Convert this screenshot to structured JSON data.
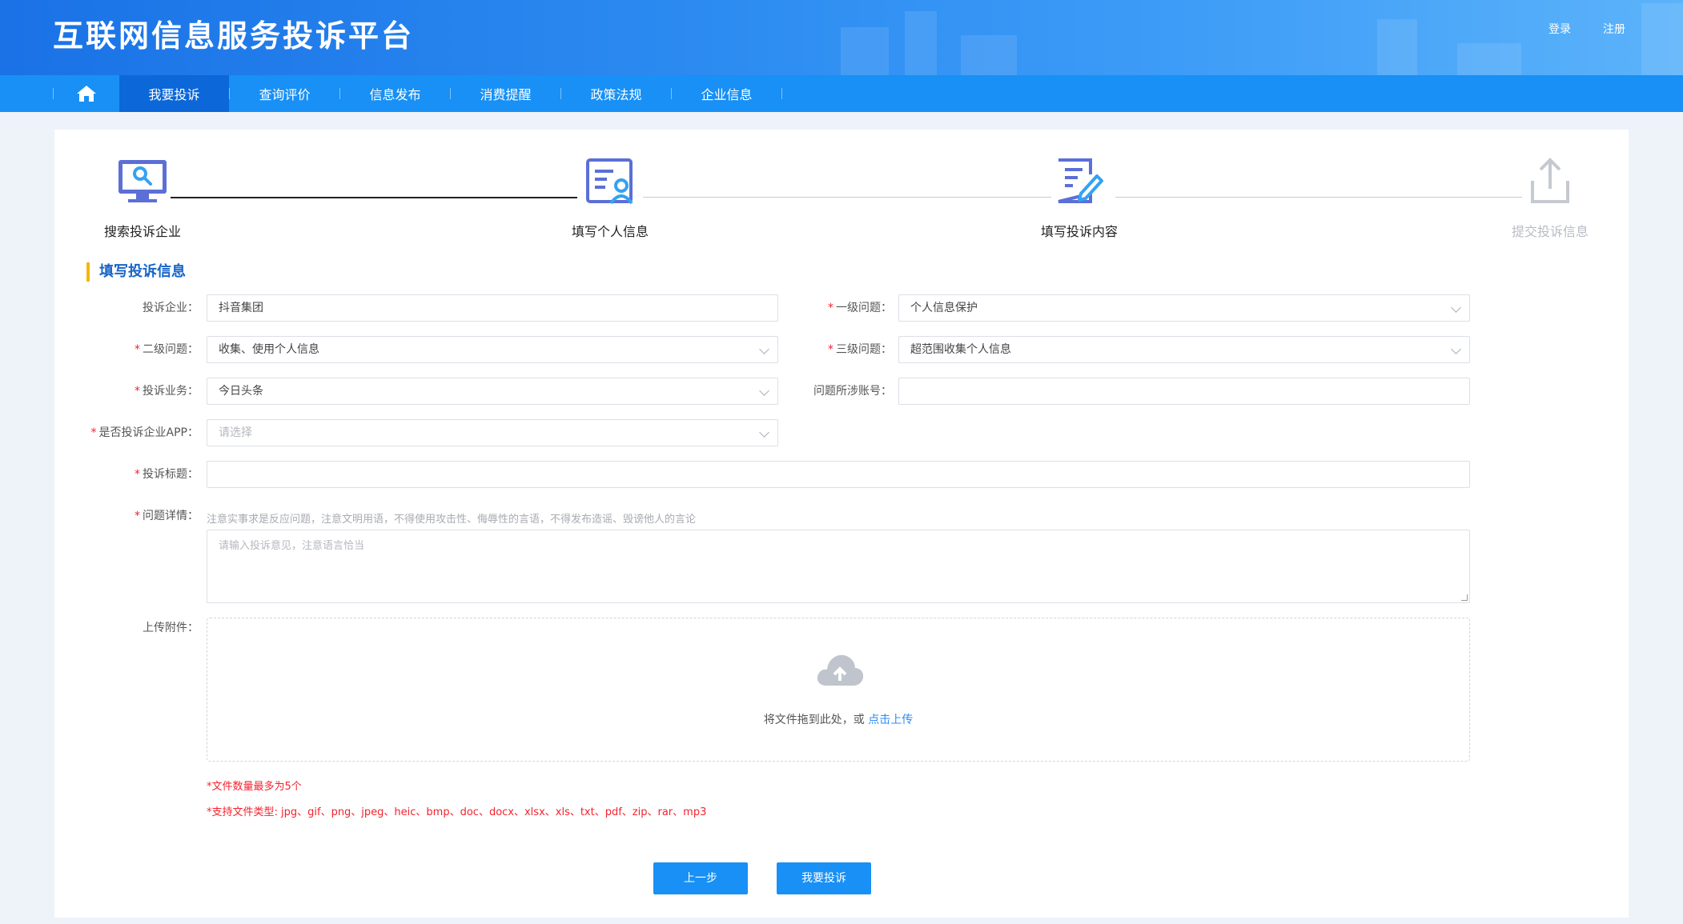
{
  "header": {
    "title": "互联网信息服务投诉平台",
    "login": "登录",
    "register": "注册"
  },
  "nav": {
    "home_icon": "home-icon",
    "items": [
      "我要投诉",
      "查询评价",
      "信息发布",
      "消费提醒",
      "政策法规",
      "企业信息"
    ],
    "active": "我要投诉"
  },
  "steps": [
    {
      "label": "搜索投诉企业",
      "icon": "search-monitor-icon",
      "state": "done"
    },
    {
      "label": "填写个人信息",
      "icon": "id-card-icon",
      "state": "done"
    },
    {
      "label": "填写投诉内容",
      "icon": "edit-document-icon",
      "state": "current"
    },
    {
      "label": "提交投诉信息",
      "icon": "upload-icon",
      "state": "todo"
    }
  ],
  "section_title": "填写投诉信息",
  "form": {
    "company": {
      "label": "投诉企业：",
      "value": "抖音集团"
    },
    "level1": {
      "label": "一级问题：",
      "value": "个人信息保护"
    },
    "level2": {
      "label": "二级问题：",
      "value": "收集、使用个人信息"
    },
    "level3": {
      "label": "三级问题：",
      "value": "超范围收集个人信息"
    },
    "business": {
      "label": "投诉业务：",
      "value": "今日头条"
    },
    "account": {
      "label": "问题所涉账号：",
      "value": ""
    },
    "is_app": {
      "label": "是否投诉企业APP：",
      "placeholder": "请选择"
    },
    "title": {
      "label": "投诉标题：",
      "value": ""
    },
    "detail": {
      "label": "问题详情：",
      "hint": "注意实事求是反应问题，注意文明用语，不得使用攻击性、侮辱性的言语，不得发布造谣、毁谤他人的言论",
      "placeholder": "请输入投诉意见，注意语言恰当"
    },
    "attachment": {
      "label": "上传附件：",
      "drag_text": "将文件拖到此处，或",
      "click_text": "点击上传"
    },
    "note_count": "*文件数量最多为5个",
    "note_types": "*支持文件类型: jpg、gif、png、jpeg、heic、bmp、doc、docx、xlsx、xls、txt、pdf、zip、rar、mp3"
  },
  "buttons": {
    "prev": "上一步",
    "submit": "我要投诉"
  },
  "colors": {
    "primary": "#1890f5",
    "nav_active": "#0c67d9",
    "required": "#f5222d",
    "accent_bar": "#f5b70f"
  }
}
